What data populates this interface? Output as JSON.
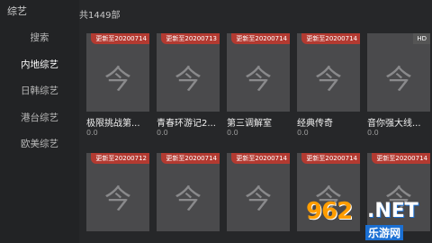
{
  "app": {
    "title": "综艺"
  },
  "sidebar": {
    "items": [
      {
        "label": "搜索",
        "active": false
      },
      {
        "label": "内地综艺",
        "active": true
      },
      {
        "label": "日韩综艺",
        "active": false
      },
      {
        "label": "港台综艺",
        "active": false
      },
      {
        "label": "欧美综艺",
        "active": false
      }
    ]
  },
  "content": {
    "count": "共1449部",
    "placeholder_glyph": "今",
    "cards": [
      {
        "title": "极限挑战第...",
        "score": "0.0",
        "badge": "更新至20200714",
        "hd": ""
      },
      {
        "title": "青春环游记2...",
        "score": "0.0",
        "badge": "更新至20200713",
        "hd": ""
      },
      {
        "title": "第三调解室",
        "score": "0.0",
        "badge": "更新至20200714",
        "hd": ""
      },
      {
        "title": "经典传奇",
        "score": "0.0",
        "badge": "更新至20200714",
        "hd": ""
      },
      {
        "title": "音你强大线...",
        "score": "0.0",
        "badge": "",
        "hd": "HD"
      },
      {
        "title": "",
        "score": "",
        "badge": "更新至20200712",
        "hd": ""
      },
      {
        "title": "",
        "score": "",
        "badge": "更新至20200714",
        "hd": ""
      },
      {
        "title": "",
        "score": "",
        "badge": "更新至20200714",
        "hd": ""
      },
      {
        "title": "",
        "score": "",
        "badge": "更新至20200714",
        "hd": ""
      },
      {
        "title": "",
        "score": "",
        "badge": "更新至20200714",
        "hd": ""
      }
    ]
  },
  "watermark": {
    "number": "962",
    "net": ".NET",
    "sub": "乐游网"
  },
  "colors": {
    "badge": "#b33a31",
    "background": "#262729",
    "poster": "#4a4a4c"
  }
}
